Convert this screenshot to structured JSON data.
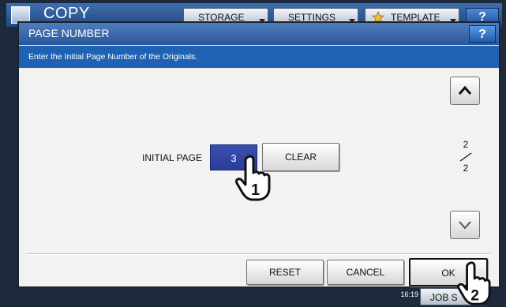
{
  "app": {
    "title": "COPY",
    "tabs": [
      {
        "label": "STORAGE"
      },
      {
        "label": "SETTINGS"
      },
      {
        "label": "TEMPLATE"
      }
    ],
    "help_label": "?",
    "job_button_label": "JOB S",
    "status_time": "16:19"
  },
  "dialog": {
    "title": "PAGE NUMBER",
    "help_label": "?",
    "message": "Enter the Initial Page Number of the Originals.",
    "field_label": "INITIAL PAGE",
    "field_value": "3",
    "clear_label": "CLEAR",
    "page_indicator": {
      "current": "2",
      "total": "2"
    },
    "buttons": {
      "reset": "RESET",
      "cancel": "CANCEL",
      "ok": "OK"
    }
  },
  "callouts": {
    "step1": "1",
    "step2": "2"
  },
  "colors": {
    "title_bar": "#3a6aab",
    "message_bar": "#1f62b4",
    "value_box": "#3346a6"
  }
}
